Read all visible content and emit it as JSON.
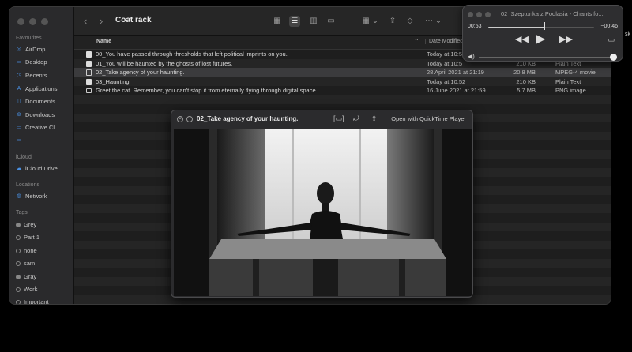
{
  "finder": {
    "title": "Coat rack",
    "sidebar": {
      "favourites_label": "Favourites",
      "favourites": [
        "AirDrop",
        "Desktop",
        "Recents",
        "Applications",
        "Documents",
        "Downloads",
        "Creative Cl..."
      ],
      "icloud_label": "iCloud",
      "icloud": [
        "iCloud Drive"
      ],
      "locations_label": "Locations",
      "locations": [
        "Network"
      ],
      "tags_label": "Tags",
      "tags": [
        "Grey",
        "Part 1",
        "none",
        "sam",
        "Gray",
        "Work",
        "Important"
      ]
    },
    "columns": {
      "name": "Name",
      "date": "Date Modified"
    },
    "files": [
      {
        "name": "00_You have passed through thresholds that left political imprints on you.",
        "date": "Today at 10:5",
        "size": "",
        "kind": "",
        "icon": "document-icon"
      },
      {
        "name": "01_You will be haunted by the ghosts of lost futures.",
        "date": "Today at 10:5",
        "size": "210 KB",
        "kind": "Plain Text",
        "icon": "document-icon"
      },
      {
        "name": "02_Take agency of your haunting.",
        "date": "28 April 2021 at 21:19",
        "size": "20.8 MB",
        "kind": "MPEG-4 movie",
        "icon": "movie-icon",
        "selected": true
      },
      {
        "name": "03_Haunting",
        "date": "Today at 10:52",
        "size": "210 KB",
        "kind": "Plain Text",
        "icon": "document-icon"
      },
      {
        "name": "Greet the cat. Remember, you can't stop it from eternally flying through digital space.",
        "date": "16 June 2021 at 21:59",
        "size": "5.7 MB",
        "kind": "PNG image",
        "icon": "image-icon"
      }
    ]
  },
  "player": {
    "title": "02_Szeptunka z Podlasia - Chants fo...",
    "elapsed": "00:53",
    "remaining": "−00:46",
    "progress": 0.53,
    "volume": 0.97,
    "edge_text": "sk"
  },
  "quicklook": {
    "title": "02_Take agency of your haunting.",
    "open_with": "Open with QuickTime Player"
  }
}
